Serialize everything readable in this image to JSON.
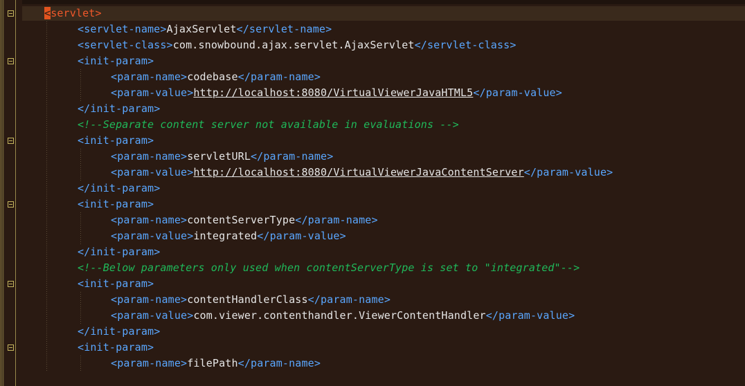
{
  "lines": [
    {
      "indent": 0,
      "open": "servlet",
      "fold": true,
      "current": true
    },
    {
      "indent": 1,
      "open": "servlet-name",
      "value": "AjaxServlet",
      "close": "servlet-name"
    },
    {
      "indent": 1,
      "open": "servlet-class",
      "value": "com.snowbound.ajax.servlet.AjaxServlet",
      "close": "servlet-class"
    },
    {
      "indent": 1,
      "open": "init-param",
      "fold": true
    },
    {
      "indent": 2,
      "open": "param-name",
      "value": "codebase",
      "close": "param-name"
    },
    {
      "indent": 2,
      "open": "param-value",
      "value": "http://localhost:8080/VirtualViewerJavaHTML5",
      "url": true,
      "close": "param-value"
    },
    {
      "indent": 1,
      "closeOnly": "init-param"
    },
    {
      "indent": 1,
      "comment": "<!--Separate content server not available in evaluations -->"
    },
    {
      "indent": 1,
      "open": "init-param",
      "fold": true
    },
    {
      "indent": 2,
      "open": "param-name",
      "value": "servletURL",
      "close": "param-name"
    },
    {
      "indent": 2,
      "open": "param-value",
      "value": "http://localhost:8080/VirtualViewerJavaContentServer",
      "url": true,
      "close": "param-value"
    },
    {
      "indent": 1,
      "closeOnly": "init-param"
    },
    {
      "indent": 1,
      "open": "init-param",
      "fold": true
    },
    {
      "indent": 2,
      "open": "param-name",
      "value": "contentServerType",
      "close": "param-name"
    },
    {
      "indent": 2,
      "open": "param-value",
      "value": "integrated",
      "close": "param-value"
    },
    {
      "indent": 1,
      "closeOnly": "init-param"
    },
    {
      "indent": 1,
      "comment": "<!--Below parameters only used when contentServerType is set to \"integrated\"-->"
    },
    {
      "indent": 1,
      "open": "init-param",
      "fold": true
    },
    {
      "indent": 2,
      "open": "param-name",
      "value": "contentHandlerClass",
      "close": "param-name"
    },
    {
      "indent": 2,
      "open": "param-value",
      "value": "com.viewer.contenthandler.ViewerContentHandler",
      "close": "param-value"
    },
    {
      "indent": 1,
      "closeOnly": "init-param"
    },
    {
      "indent": 1,
      "open": "init-param",
      "fold": true
    },
    {
      "indent": 2,
      "open": "param-name",
      "value": "filePath",
      "close": "param-name"
    }
  ],
  "colors": {
    "background": "#2a1a12",
    "tag": "#5aa7ff",
    "text": "#e6e6e6",
    "comment": "#1fb95a",
    "caret_highlight": "#e2541f"
  }
}
